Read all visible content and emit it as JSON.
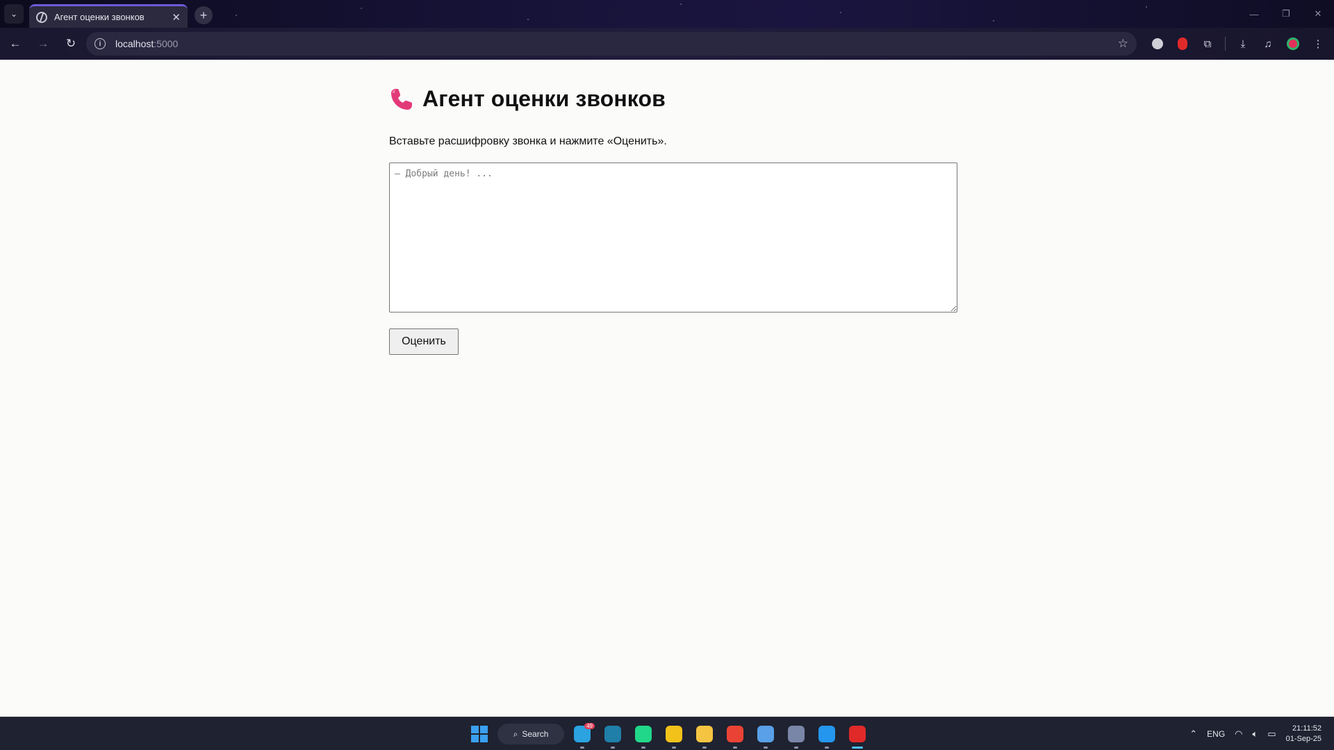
{
  "browser": {
    "tab_title": "Агент оценки звонков",
    "url_host": "localhost",
    "url_port": ":5000",
    "tab_close_glyph": "✕",
    "new_tab_glyph": "+",
    "nav": {
      "back_glyph": "←",
      "forward_glyph": "→",
      "reload_glyph": "↻"
    }
  },
  "page": {
    "title": "Агент оценки звонков",
    "title_icon": "telephone-receiver-icon",
    "instruction": "Вставьте расшифровку звонка и нажмите «Оценить».",
    "transcript_placeholder": "— Добрый день! ...",
    "transcript_value": "",
    "submit_label": "Оценить"
  },
  "taskbar": {
    "search_label": "Search",
    "apps": [
      {
        "name": "telegram-icon",
        "color": "#2aa3e0",
        "badge": "49"
      },
      {
        "name": "app-icon-2",
        "color": "#1f7fa8",
        "badge": ""
      },
      {
        "name": "pycharm-icon",
        "color": "#21d789",
        "badge": ""
      },
      {
        "name": "app-icon-4",
        "color": "#f2c21b",
        "badge": ""
      },
      {
        "name": "file-explorer-icon",
        "color": "#f5c542",
        "badge": ""
      },
      {
        "name": "chrome-icon",
        "color": "#ea4335",
        "badge": ""
      },
      {
        "name": "app-icon-7",
        "color": "#5aa0e8",
        "badge": ""
      },
      {
        "name": "app-icon-8",
        "color": "#7a86a8",
        "badge": ""
      },
      {
        "name": "docker-icon",
        "color": "#2496ed",
        "badge": ""
      },
      {
        "name": "recorder-icon",
        "color": "#e02a2a",
        "badge": ""
      }
    ],
    "tray_language": "ENG",
    "clock_time": "21:11:52",
    "clock_date": "01-Sep-25"
  },
  "colors": {
    "accent_tab": "#6c5bd8",
    "phone_icon": "#e23a78",
    "page_background": "#fbfbfa"
  }
}
